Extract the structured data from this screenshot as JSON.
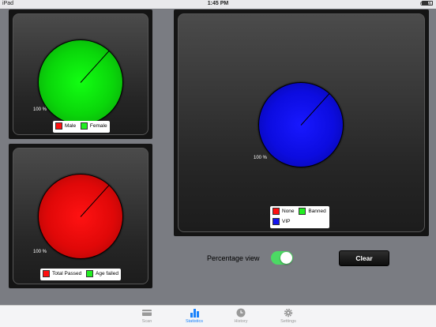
{
  "status_bar": {
    "device": "iPad",
    "time": "1:45 PM",
    "battery": "62%"
  },
  "colors": {
    "red": "#ff1010",
    "green": "#10e010",
    "blue": "#1414ee",
    "toggle_on": "#4cd964",
    "tab_active": "#1a82fb"
  },
  "gender_panel": {
    "percent_label": "100 %",
    "legend": [
      {
        "label": "Male",
        "color": "#ff1010"
      },
      {
        "label": "Female",
        "color": "#22ee22"
      }
    ],
    "chart_data": {
      "type": "pie",
      "categories": [
        "Male",
        "Female"
      ],
      "values": [
        0,
        100
      ]
    }
  },
  "age_panel": {
    "percent_label": "100 %",
    "legend": [
      {
        "label": "Total Passed",
        "color": "#ff1010"
      },
      {
        "label": "Age failed",
        "color": "#22ee22"
      }
    ],
    "chart_data": {
      "type": "pie",
      "categories": [
        "Total Passed",
        "Age failed"
      ],
      "values": [
        100,
        0
      ]
    }
  },
  "status_panel": {
    "percent_label": "100 %",
    "legend": [
      {
        "label": "None",
        "color": "#ff1010"
      },
      {
        "label": "Banned",
        "color": "#22ee22"
      },
      {
        "label": "VIP",
        "color": "#1414ee"
      }
    ],
    "chart_data": {
      "type": "pie",
      "categories": [
        "None",
        "Banned",
        "VIP"
      ],
      "values": [
        0,
        0,
        100
      ]
    }
  },
  "controls": {
    "percentage_view_label": "Percentage view",
    "percentage_view_on": true,
    "clear_label": "Clear"
  },
  "tabs": [
    {
      "label": "Scan",
      "icon": "card-icon",
      "active": false
    },
    {
      "label": "Statistics",
      "icon": "bar-chart-icon",
      "active": true
    },
    {
      "label": "History",
      "icon": "clock-icon",
      "active": false
    },
    {
      "label": "Settings",
      "icon": "gear-icon",
      "active": false
    }
  ]
}
